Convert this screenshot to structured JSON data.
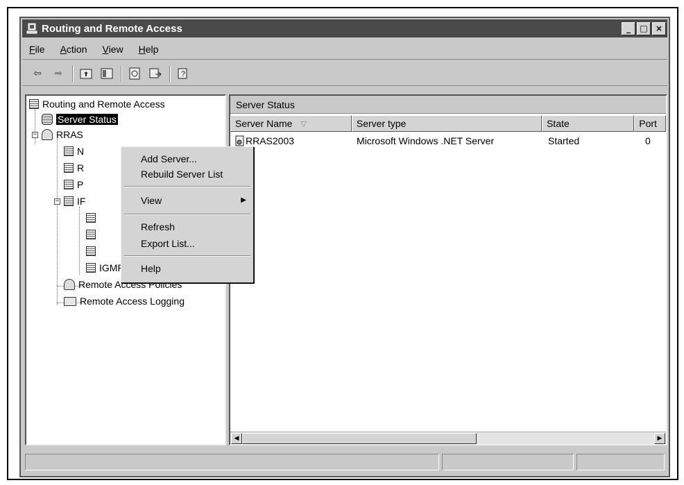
{
  "window": {
    "title": "Routing and Remote Access",
    "controls": [
      "minimize",
      "maximize",
      "close"
    ]
  },
  "menubar": {
    "items": [
      "File",
      "Action",
      "View",
      "Help"
    ]
  },
  "toolbar": {
    "buttons": [
      "back-icon",
      "forward-icon",
      "up-level-icon",
      "show-hide-tree-icon",
      "refresh-icon",
      "export-list-icon",
      "help-icon"
    ]
  },
  "tree": {
    "root": "Routing and Remote Access",
    "server_status": "Server Status",
    "server_node": "RRAS",
    "child_n": "N",
    "child_r": "R",
    "child_p": "P",
    "child_ip": "IF",
    "igmp": "IGMP",
    "remote_access_policies": "Remote Access Policies",
    "remote_access_logging": "Remote Access Logging"
  },
  "context_menu": {
    "add_server": "Add Server...",
    "rebuild_server_list": "Rebuild Server List",
    "view": "View",
    "refresh": "Refresh",
    "export_list": "Export List...",
    "help": "Help"
  },
  "details": {
    "header": "Server Status",
    "columns": [
      "Server Name",
      "Server type",
      "State",
      "Port"
    ],
    "rows": [
      {
        "server_name": "RRAS2003",
        "server_type": "Microsoft Windows .NET Server",
        "state": "Started",
        "port": "0"
      }
    ]
  },
  "colors": {
    "titlebar": "#4a4a4a",
    "chrome": "#c9c9c9",
    "selection": "#000000"
  }
}
